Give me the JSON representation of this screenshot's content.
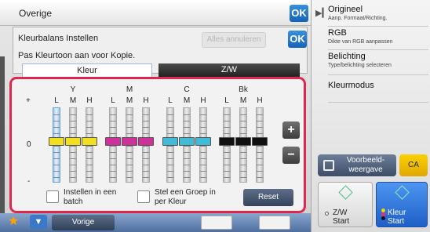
{
  "screen": {
    "title": "Overige",
    "ok_label": "OK",
    "back_label": "Vorige"
  },
  "dialog": {
    "title": "Kleurbalans Instellen",
    "subtitle": "Pas Kleurtoon aan voor Kopie.",
    "cancel_all_label": "Alles annuleren",
    "ok_label": "OK",
    "tabs": [
      {
        "label": "Kleur",
        "selected": true
      },
      {
        "label": "Z/W",
        "selected": false
      }
    ]
  },
  "balance": {
    "axis": {
      "plus": "+",
      "zero": "0",
      "minus": "-"
    },
    "groups": [
      {
        "label": "Y",
        "color": "#f0e020",
        "levels": [
          "L",
          "M",
          "H"
        ],
        "values": [
          0,
          0,
          0
        ]
      },
      {
        "label": "M",
        "color": "#d0309a",
        "levels": [
          "L",
          "M",
          "H"
        ],
        "values": [
          0,
          0,
          0
        ]
      },
      {
        "label": "C",
        "color": "#40bcd8",
        "levels": [
          "L",
          "M",
          "H"
        ],
        "values": [
          0,
          0,
          0
        ]
      },
      {
        "label": "Bk",
        "color": "#111111",
        "levels": [
          "L",
          "M",
          "H"
        ],
        "values": [
          0,
          0,
          0
        ]
      }
    ],
    "plus_label": "+",
    "minus_label": "−",
    "batch_label": "Instellen in een batch",
    "group_label": "Stel een Groep in per Kleur",
    "reset_label": "Reset"
  },
  "right_panel": {
    "menu": [
      {
        "title": "Origineel",
        "sub": "Aanp. Formaat/Richting."
      },
      {
        "title": "RGB",
        "sub": "Dikte van RGB aanpassen"
      },
      {
        "title": "Belichting",
        "sub": "Type/belichting selecteren"
      },
      {
        "title": "Kleurmodus",
        "sub": ""
      }
    ],
    "preview_label": "Voorbeeld-weergave",
    "ca_label": "CA",
    "zw_mode": "Z/W",
    "kleur_mode": "Kleur",
    "start_label": "Start"
  }
}
